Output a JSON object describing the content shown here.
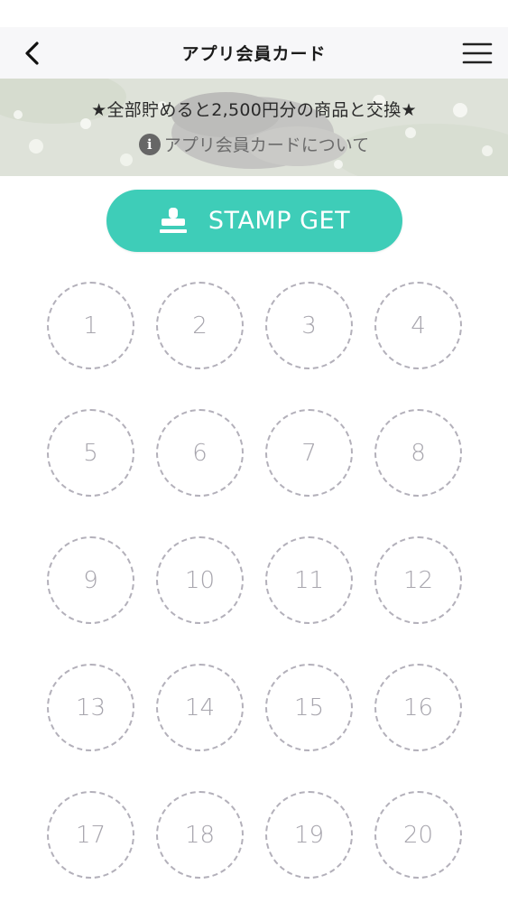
{
  "header": {
    "title": "アプリ会員カード",
    "back_icon": "chevron-left-icon",
    "menu_icon": "hamburger-menu-icon"
  },
  "banner": {
    "headline": "★全部貯めると2,500円分の商品と交換★",
    "info_icon": "info-circle-icon",
    "info_link": "アプリ会員カードについて"
  },
  "stamp_button": {
    "label": "STAMP GET",
    "icon": "stamp-icon",
    "color": "#3ecdb8"
  },
  "stamps": [
    "1",
    "2",
    "3",
    "4",
    "5",
    "6",
    "7",
    "8",
    "9",
    "10",
    "11",
    "12",
    "13",
    "14",
    "15",
    "16",
    "17",
    "18",
    "19",
    "20"
  ]
}
